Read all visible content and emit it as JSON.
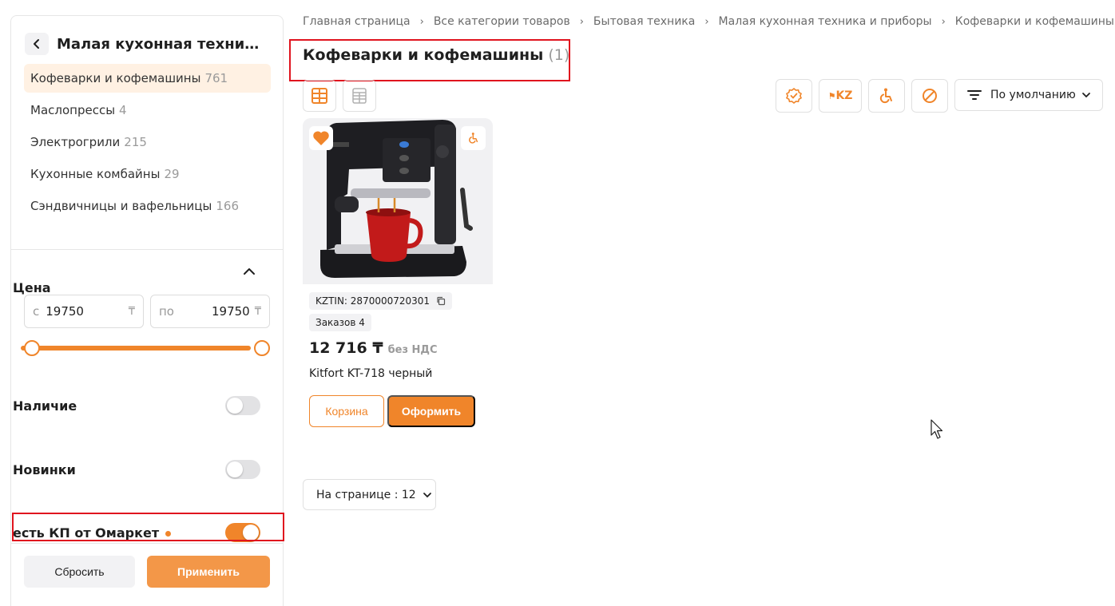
{
  "sidebar": {
    "category_title": "Малая кухонная техника и приборы",
    "categories": [
      {
        "label": "Кофеварки и кофемашины",
        "count": "761",
        "active": true
      },
      {
        "label": "Маслопрессы",
        "count": "4"
      },
      {
        "label": "Электрогрили",
        "count": "215"
      },
      {
        "label": "Кухонные комбайны",
        "count": "29"
      },
      {
        "label": "Сэндвичницы и вафельницы",
        "count": "166"
      }
    ],
    "price": {
      "title": "Цена",
      "from_prefix": "с",
      "from_value": "19750",
      "to_prefix": "по",
      "to_value": "19750",
      "currency": "₸"
    },
    "toggles": [
      {
        "label": "Наличие",
        "on": false
      },
      {
        "label": "Новинки",
        "on": false
      },
      {
        "label": "есть КП от Омаркет",
        "on": true
      }
    ],
    "reset_label": "Сбросить",
    "apply_label": "Применить"
  },
  "breadcrumb": [
    "Главная страница",
    "Все категории товаров",
    "Бытовая техника",
    "Малая кухонная техника и приборы",
    "Кофеварки и кофемашины"
  ],
  "page": {
    "title": "Кофеварки и кофемашины",
    "count": "(1)"
  },
  "toolbar": {
    "kz_label": "KZ",
    "sort_label": "По умолчанию"
  },
  "product": {
    "kztin": "KZTIN: 2870000720301",
    "orders": "Заказов 4",
    "price": "12 716 ₸",
    "nds": "без НДС",
    "name": "Kitfort KT-718 черный",
    "cart_label": "Корзина",
    "order_label": "Оформить"
  },
  "pagination": {
    "per_page_label": "На странице : 12"
  },
  "colors": {
    "accent": "#f0852a",
    "active_bg": "#fff1e3",
    "highlight_red": "#e0141e"
  }
}
